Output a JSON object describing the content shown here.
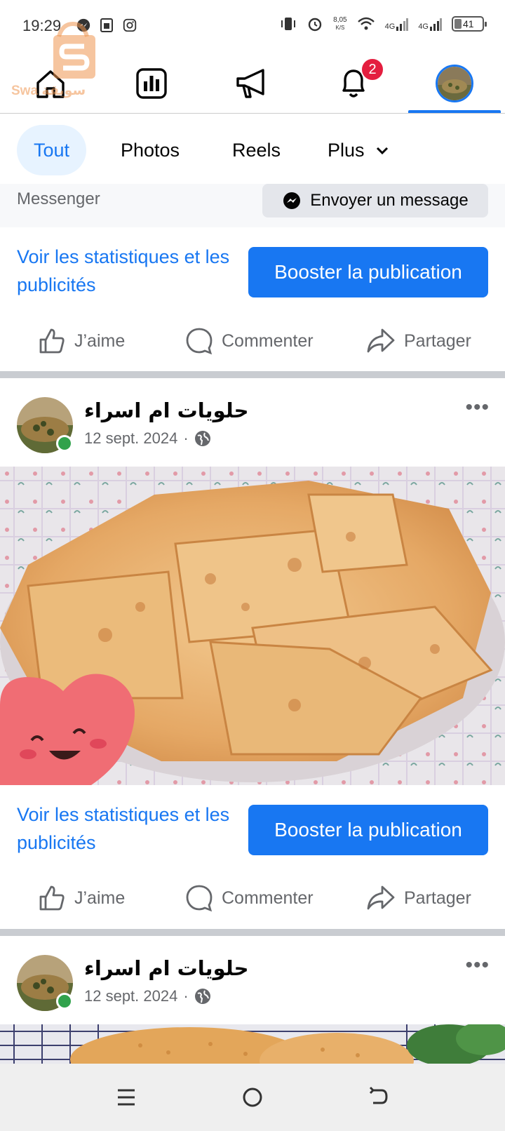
{
  "status_bar": {
    "time": "19:29",
    "speed_value": "8,05",
    "speed_unit": "K/S",
    "net1": "4G",
    "net2": "4G",
    "battery": "41"
  },
  "watermark": {
    "text": "Swa سويقة"
  },
  "top_nav": {
    "items": [
      {
        "name": "home-icon"
      },
      {
        "name": "dashboard-icon"
      },
      {
        "name": "megaphone-icon"
      },
      {
        "name": "bell-icon"
      },
      {
        "name": "profile-avatar"
      }
    ],
    "notification_count": "2",
    "active_index": 4
  },
  "filters": {
    "tabs": [
      "Tout",
      "Photos",
      "Reels",
      "Plus"
    ],
    "active": "Tout"
  },
  "messenger": {
    "label": "Messenger",
    "button": "Envoyer un message"
  },
  "posts": [
    {
      "stats_link": "Voir les statistiques et les publicités",
      "boost": "Booster la publication",
      "actions": [
        "J’aime",
        "Commenter",
        "Partager"
      ]
    },
    {
      "author": "حلويات ام اسراء",
      "date": "12 sept. 2024",
      "separator": "·",
      "privacy_icon": "globe-icon",
      "stats_link": "Voir les statistiques et les publicités",
      "boost": "Booster la publication",
      "actions": [
        "J’aime",
        "Commenter",
        "Partager"
      ]
    },
    {
      "author": "حلويات ام اسراء",
      "date": "12 sept. 2024",
      "separator": "·",
      "privacy_icon": "globe-icon"
    }
  ],
  "colors": {
    "accent": "#1877f2",
    "badge": "#e41e3f",
    "online": "#31a24c",
    "secondary_text": "#65676b"
  }
}
